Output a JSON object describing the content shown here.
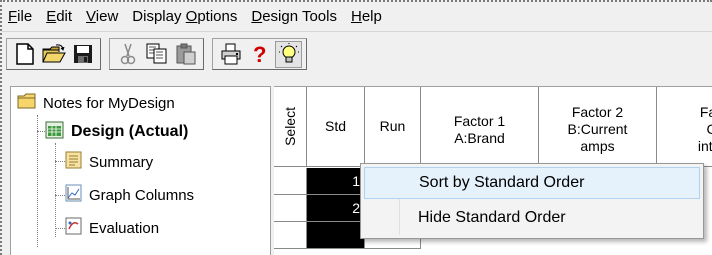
{
  "menubar": {
    "items": [
      {
        "label": "File",
        "mnemonic": "F"
      },
      {
        "label": "Edit",
        "mnemonic": "E"
      },
      {
        "label": "View",
        "mnemonic": "V"
      },
      {
        "label": "Display Options",
        "mnemonic": "O"
      },
      {
        "label": "Design Tools",
        "mnemonic": "D"
      },
      {
        "label": "Help",
        "mnemonic": "H"
      }
    ]
  },
  "toolbar": {
    "groups": [
      [
        "new-document-icon",
        "open-folder-icon",
        "save-disk-icon"
      ],
      [
        "cut-scissors-icon",
        "copy-icon",
        "paste-icon"
      ],
      [
        "print-icon",
        "help-question-icon",
        "tip-lightbulb-icon"
      ]
    ]
  },
  "tree": {
    "items": [
      {
        "label": "Notes for MyDesign",
        "icon": "folder-icon"
      },
      {
        "label": "Design (Actual)",
        "icon": "design-grid-icon"
      },
      {
        "label": "Summary",
        "icon": "summary-icon"
      },
      {
        "label": "Graph Columns",
        "icon": "graph-columns-icon"
      },
      {
        "label": "Evaluation",
        "icon": "evaluation-icon"
      }
    ]
  },
  "grid": {
    "headers": {
      "select": "Select",
      "std": "Std",
      "run": "Run",
      "factor1_line1": "Factor 1",
      "factor1_line2": "A:Brand",
      "factor2_line1": "Factor 2",
      "factor2_line2": "B:Current",
      "factor2_line3": "amps",
      "factor3_line1": "Fac",
      "factor3_line2": "C",
      "factor3_line3": "inter"
    },
    "rows": [
      {
        "std": "1"
      },
      {
        "std": "2"
      }
    ]
  },
  "context_menu": {
    "items": [
      {
        "label": "Sort by Standard Order",
        "highlighted": true
      },
      {
        "label": "Hide Standard Order",
        "highlighted": false
      }
    ]
  },
  "colors": {
    "highlight_bg": "#e5f1fb",
    "highlight_border": "#b0d2ef",
    "selected_cell": "#000000"
  }
}
